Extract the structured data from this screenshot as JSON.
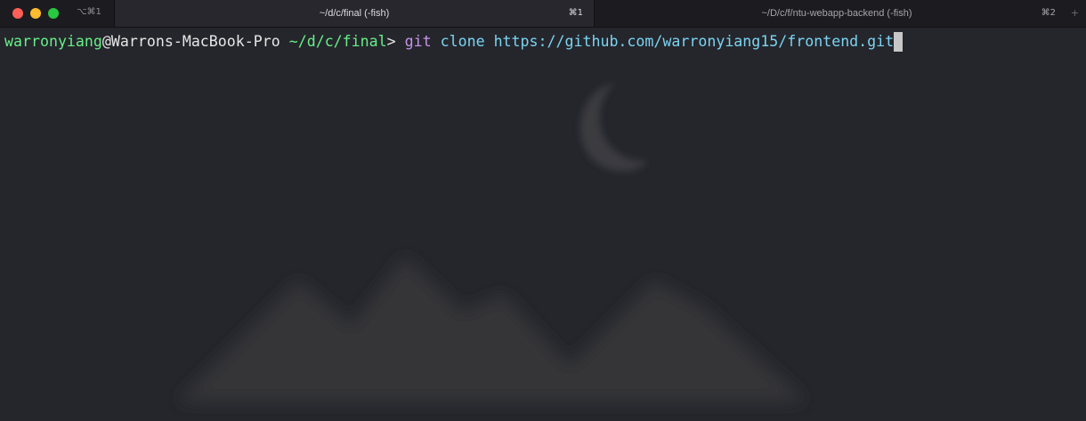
{
  "window": {
    "shortcut": "⌥⌘1"
  },
  "tabs": [
    {
      "title": "~/d/c/final (-fish)",
      "shortcut": "⌘1",
      "active": true
    },
    {
      "title": "~/D/c/f/ntu-webapp-backend (-fish)",
      "shortcut": "⌘2",
      "active": false
    }
  ],
  "new_tab_label": "+",
  "terminal": {
    "user": "warronyiang",
    "at": "@",
    "host": "Warrons-MacBook-Pro",
    "cwd": "~/d/c/final",
    "prompt_symbol": ">",
    "command": "git",
    "args": "clone https://github.com/warronyiang15/frontend.git"
  },
  "colors": {
    "background": "#25262c",
    "prompt_green": "#66ef86",
    "command_purple": "#c792ea",
    "args_cyan": "#7ad4f2",
    "close": "#fe5f57",
    "minimize": "#febc2e",
    "maximize": "#28c840"
  }
}
